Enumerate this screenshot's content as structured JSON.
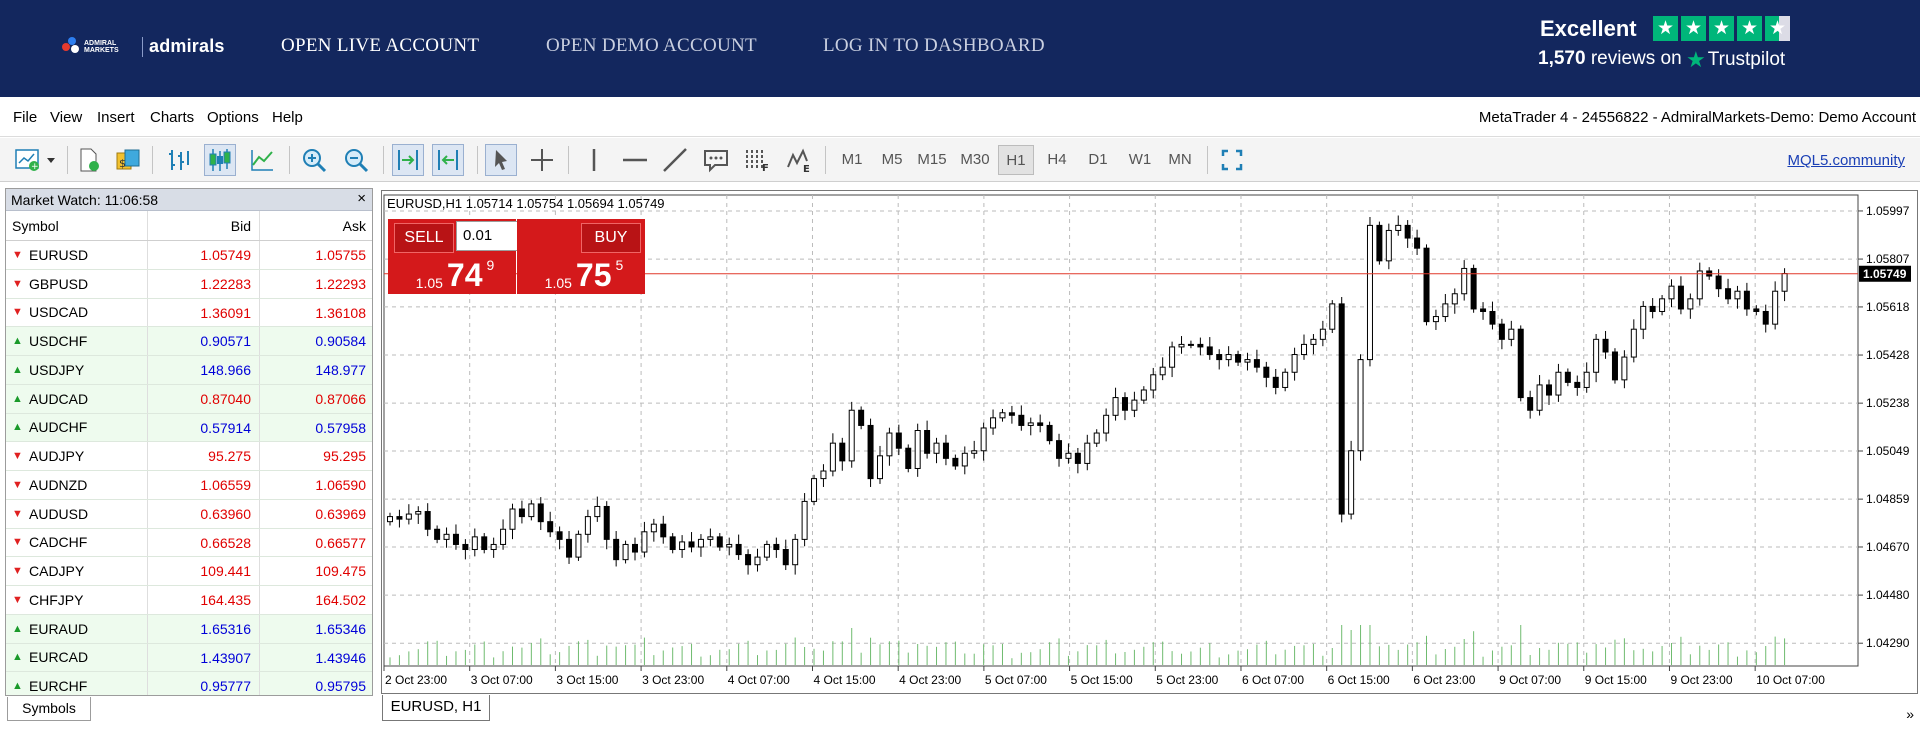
{
  "header": {
    "logo_sub": "ADMIRAL MARKETS",
    "logo_name": "admirals",
    "links": [
      "OPEN LIVE ACCOUNT",
      "OPEN DEMO ACCOUNT",
      "LOG IN TO DASHBOARD"
    ],
    "trustpilot": {
      "rating": "Excellent",
      "stars": 4.5,
      "reviews": "1,570",
      "reviews_suffix": "reviews on",
      "brand": "Trustpilot"
    }
  },
  "menu": {
    "items": [
      "File",
      "View",
      "Insert",
      "Charts",
      "Options",
      "Help"
    ],
    "account": "MetaTrader 4 - 24556822 - AdmiralMarkets-Demo: Demo Account"
  },
  "toolbar": {
    "timeframes": [
      "M1",
      "M5",
      "M15",
      "M30",
      "H1",
      "H4",
      "D1",
      "W1",
      "MN"
    ],
    "active_timeframe": "H1",
    "community_link": "MQL5.community"
  },
  "market_watch": {
    "title": "Market Watch: 11:06:58",
    "close": "×",
    "columns": [
      "Symbol",
      "Bid",
      "Ask"
    ],
    "rows": [
      {
        "symbol": "EURUSD",
        "bid": "1.05749",
        "ask": "1.05755",
        "dir": "down",
        "color": "red"
      },
      {
        "symbol": "GBPUSD",
        "bid": "1.22283",
        "ask": "1.22293",
        "dir": "down",
        "color": "red"
      },
      {
        "symbol": "USDCAD",
        "bid": "1.36091",
        "ask": "1.36108",
        "dir": "down",
        "color": "red"
      },
      {
        "symbol": "USDCHF",
        "bid": "0.90571",
        "ask": "0.90584",
        "dir": "up",
        "color": "blue"
      },
      {
        "symbol": "USDJPY",
        "bid": "148.966",
        "ask": "148.977",
        "dir": "up",
        "color": "blue"
      },
      {
        "symbol": "AUDCAD",
        "bid": "0.87040",
        "ask": "0.87066",
        "dir": "up",
        "color": "red"
      },
      {
        "symbol": "AUDCHF",
        "bid": "0.57914",
        "ask": "0.57958",
        "dir": "up",
        "color": "blue"
      },
      {
        "symbol": "AUDJPY",
        "bid": "95.275",
        "ask": "95.295",
        "dir": "down",
        "color": "red"
      },
      {
        "symbol": "AUDNZD",
        "bid": "1.06559",
        "ask": "1.06590",
        "dir": "down",
        "color": "red"
      },
      {
        "symbol": "AUDUSD",
        "bid": "0.63960",
        "ask": "0.63969",
        "dir": "down",
        "color": "red"
      },
      {
        "symbol": "CADCHF",
        "bid": "0.66528",
        "ask": "0.66577",
        "dir": "down",
        "color": "red"
      },
      {
        "symbol": "CADJPY",
        "bid": "109.441",
        "ask": "109.475",
        "dir": "down",
        "color": "red"
      },
      {
        "symbol": "CHFJPY",
        "bid": "164.435",
        "ask": "164.502",
        "dir": "down",
        "color": "red"
      },
      {
        "symbol": "EURAUD",
        "bid": "1.65316",
        "ask": "1.65346",
        "dir": "up",
        "color": "blue"
      },
      {
        "symbol": "EURCAD",
        "bid": "1.43907",
        "ask": "1.43946",
        "dir": "up",
        "color": "blue"
      },
      {
        "symbol": "EURCHF",
        "bid": "0.95777",
        "ask": "0.95795",
        "dir": "up",
        "color": "blue"
      }
    ],
    "tab": "Symbols"
  },
  "chart": {
    "info": "EURUSD,H1  1.05714 1.05754 1.05694 1.05749",
    "sell_label": "SELL",
    "buy_label": "BUY",
    "lot": "0.01",
    "sell_price": {
      "prefix": "1.05",
      "big": "74",
      "sup": "9"
    },
    "buy_price": {
      "prefix": "1.05",
      "big": "75",
      "sup": "5"
    },
    "tab": "EURUSD, H1",
    "current_price": "1.05749"
  },
  "chart_data": {
    "type": "candlestick",
    "symbol": "EURUSD",
    "timeframe": "H1",
    "y_ticks": [
      "1.05997",
      "1.05807",
      "1.05618",
      "1.05428",
      "1.05238",
      "1.05049",
      "1.04859",
      "1.04670",
      "1.04480",
      "1.04290"
    ],
    "ylim": [
      1.042,
      1.0606
    ],
    "x_ticks": [
      "2 Oct 23:00",
      "3 Oct 07:00",
      "3 Oct 15:00",
      "3 Oct 23:00",
      "4 Oct 07:00",
      "4 Oct 15:00",
      "4 Oct 23:00",
      "5 Oct 07:00",
      "5 Oct 15:00",
      "5 Oct 23:00",
      "6 Oct 07:00",
      "6 Oct 15:00",
      "6 Oct 23:00",
      "9 Oct 07:00",
      "9 Oct 15:00",
      "9 Oct 23:00",
      "10 Oct 07:00"
    ],
    "close": [
      1.0479,
      1.0478,
      1.048,
      1.0481,
      1.0474,
      1.047,
      1.0472,
      1.0468,
      1.0466,
      1.0471,
      1.0466,
      1.0468,
      1.0474,
      1.0482,
      1.0479,
      1.0484,
      1.0477,
      1.0473,
      1.047,
      1.0463,
      1.0472,
      1.0479,
      1.0483,
      1.047,
      1.0462,
      1.0468,
      1.0465,
      1.0473,
      1.0476,
      1.0471,
      1.0466,
      1.0469,
      1.0467,
      1.047,
      1.0471,
      1.0467,
      1.0468,
      1.0464,
      1.046,
      1.0463,
      1.0468,
      1.0466,
      1.046,
      1.047,
      1.0485,
      1.0494,
      1.0497,
      1.0508,
      1.0501,
      1.0521,
      1.0515,
      1.0494,
      1.0503,
      1.0512,
      1.0506,
      1.0498,
      1.0513,
      1.0504,
      1.0508,
      1.0502,
      1.0499,
      1.0504,
      1.0505,
      1.0514,
      1.0518,
      1.052,
      1.0519,
      1.0515,
      1.0516,
      1.0515,
      1.0509,
      1.0502,
      1.0504,
      1.05,
      1.0508,
      1.0512,
      1.0519,
      1.0526,
      1.0521,
      1.0525,
      1.0529,
      1.0535,
      1.0538,
      1.0546,
      1.0547,
      1.0547,
      1.0546,
      1.0543,
      1.0541,
      1.0543,
      1.054,
      1.0541,
      1.0538,
      1.0534,
      1.053,
      1.0536,
      1.0543,
      1.0547,
      1.0549,
      1.0553,
      1.0563,
      1.048,
      1.0505,
      1.0541,
      1.0594,
      1.058,
      1.0592,
      1.0594,
      1.0589,
      1.0585,
      1.0556,
      1.0558,
      1.0563,
      1.0567,
      1.0577,
      1.0561,
      1.056,
      1.0555,
      1.0549,
      1.0553,
      1.0526,
      1.0521,
      1.0531,
      1.0527,
      1.0536,
      1.0532,
      1.053,
      1.0536,
      1.0549,
      1.0544,
      1.0533,
      1.0542,
      1.0553,
      1.0562,
      1.056,
      1.0565,
      1.057,
      1.0561,
      1.0565,
      1.0576,
      1.0574,
      1.0569,
      1.0565,
      1.0568,
      1.0561,
      1.056,
      1.0555,
      1.0568,
      1.0575
    ],
    "volume_color": "#6fbb6f",
    "price_line_color": "#e0392a",
    "grid": true
  }
}
